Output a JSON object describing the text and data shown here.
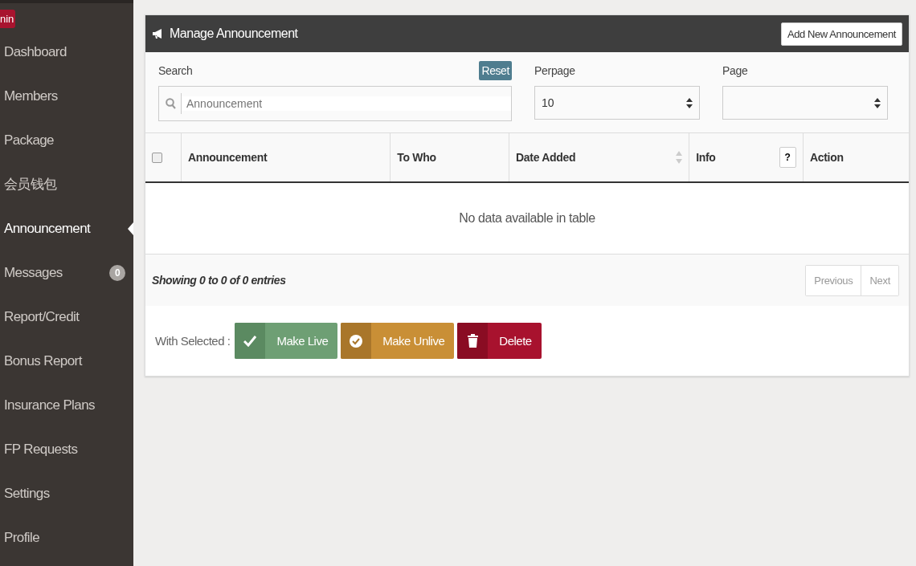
{
  "brand_badge": "nin",
  "sidebar": {
    "items": [
      {
        "label": "Dashboard",
        "selected": false
      },
      {
        "label": "Members",
        "selected": false
      },
      {
        "label": "Package",
        "selected": false
      },
      {
        "label": "会员钱包",
        "selected": false
      },
      {
        "label": "Announcement",
        "selected": true
      },
      {
        "label": "Messages",
        "selected": false,
        "badge": "0"
      },
      {
        "label": "Report/Credit",
        "selected": false
      },
      {
        "label": "Bonus Report",
        "selected": false
      },
      {
        "label": "Insurance Plans",
        "selected": false
      },
      {
        "label": "FP Requests",
        "selected": false
      },
      {
        "label": "Settings",
        "selected": false
      },
      {
        "label": "Profile",
        "selected": false
      }
    ]
  },
  "panel": {
    "title": "Manage Announcement",
    "add_button": "Add New Announcement"
  },
  "filters": {
    "search_label": "Search",
    "reset_button": "Reset",
    "search_placeholder": "Announcement",
    "perpage_label": "Perpage",
    "perpage_value": "10",
    "page_label": "Page"
  },
  "table": {
    "select_all_checked": false,
    "columns": [
      {
        "label": "Announcement",
        "kind": "plain"
      },
      {
        "label": "To Who",
        "kind": "plain"
      },
      {
        "label": "Date Added",
        "kind": "sortable"
      },
      {
        "label": "Info",
        "kind": "help",
        "help": "?"
      },
      {
        "label": "Action",
        "kind": "plain"
      }
    ],
    "empty_message": "No data available in table",
    "info": "Showing 0 to 0 of 0 entries",
    "pagination": [
      {
        "label": "Previous",
        "disabled": true
      },
      {
        "label": "Next",
        "disabled": true
      }
    ]
  },
  "bulk": {
    "label": "With Selected :",
    "buttons": [
      {
        "label": "Make Live",
        "kind": "live"
      },
      {
        "label": "Make Unlive",
        "kind": "unlive"
      },
      {
        "label": "Delete",
        "kind": "delete"
      }
    ]
  }
}
